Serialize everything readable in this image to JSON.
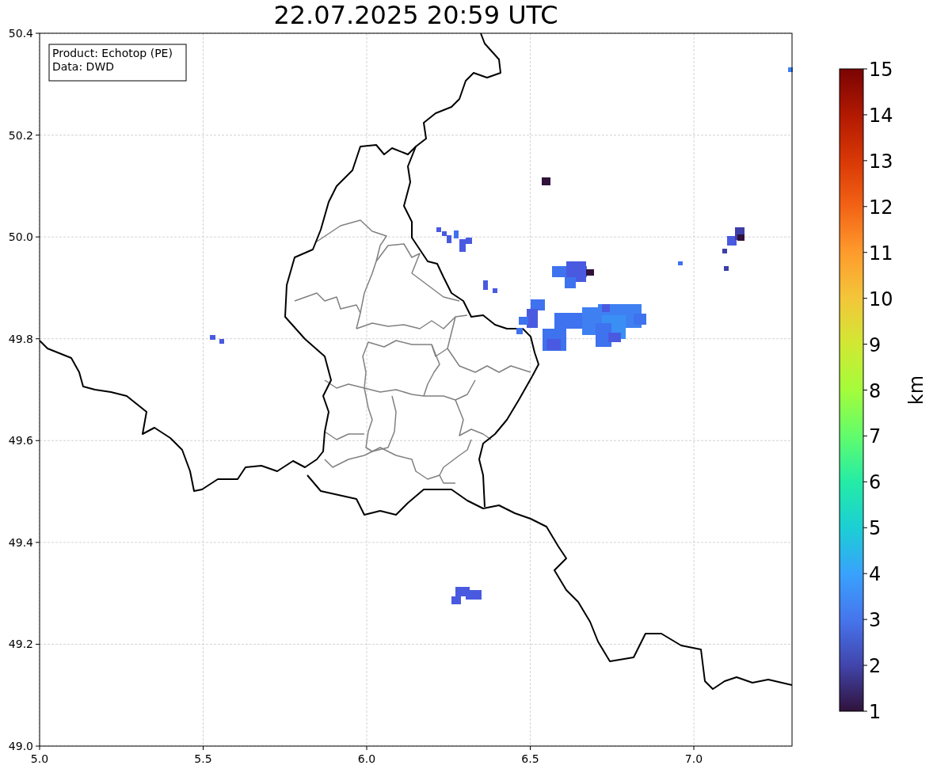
{
  "figure": {
    "title": "22.07.2025 20:59 UTC"
  },
  "map": {
    "info_box": [
      "Product: Echotop (PE)",
      "Data: DWD"
    ],
    "y_axis_labels": [
      "50.4",
      "50.2",
      "50.0",
      "49.8",
      "49.6",
      "49.4",
      "49.2",
      "49.0"
    ],
    "x_axis_labels": [
      "5.0",
      "5.5",
      "6.0",
      "6.5",
      "7.0"
    ]
  },
  "colorbar": {
    "label": "km",
    "ticks": [
      "15",
      "14",
      "13",
      "12",
      "11",
      "10",
      "9",
      "8",
      "7",
      "6",
      "5",
      "4",
      "3",
      "2",
      "1"
    ]
  }
}
